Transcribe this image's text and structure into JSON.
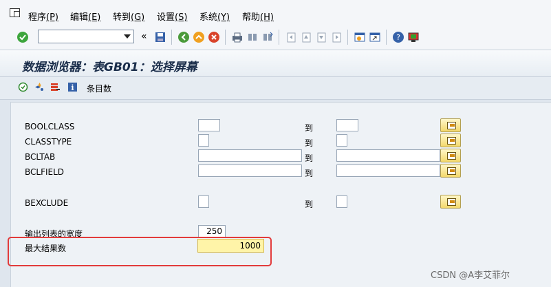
{
  "menu": {
    "items": [
      {
        "text": "程序",
        "key": "(P)"
      },
      {
        "text": "编辑",
        "key": "(E)"
      },
      {
        "text": "转到",
        "key": "(G)"
      },
      {
        "text": "设置",
        "key": "(S)"
      },
      {
        "text": "系统",
        "key": "(Y)"
      },
      {
        "text": "帮助",
        "key": "(H)"
      }
    ]
  },
  "toolbar": {
    "command_field_value": "",
    "icons": [
      "enter-icon",
      "command-field",
      "back-arrows-icon",
      "save-icon",
      "back-icon",
      "exit-icon",
      "cancel-icon",
      "print-icon",
      "find-icon",
      "find-next-icon",
      "first-page-icon",
      "prev-page-icon",
      "next-page-icon",
      "last-page-icon",
      "new-session-icon",
      "shortcut-icon",
      "help-icon",
      "customize-layout-icon"
    ]
  },
  "title": "数据浏览器：表GB01：选择屏幕",
  "app_toolbar": {
    "icons": [
      "execute-icon",
      "selection-options-icon",
      "delete-row-icon",
      "info-icon"
    ],
    "entries_label": "条目数"
  },
  "selection": {
    "to_label": "到",
    "rows": [
      {
        "field": "BOOLCLASS"
      },
      {
        "field": "CLASSTYPE"
      },
      {
        "field": "BCLTAB"
      },
      {
        "field": "BCLFIELD"
      },
      {
        "field": "BEXCLUDE"
      }
    ],
    "output_width_label": "输出列表的宽度",
    "output_width_value": "250",
    "max_hits_label": "最大结果数",
    "max_hits_value": "1000"
  },
  "watermark": "CSDN @A李艾菲尔",
  "colors": {
    "highlight_border": "#e23b3b",
    "active_input": "#fff4a8",
    "background": "#dfe6ee"
  }
}
